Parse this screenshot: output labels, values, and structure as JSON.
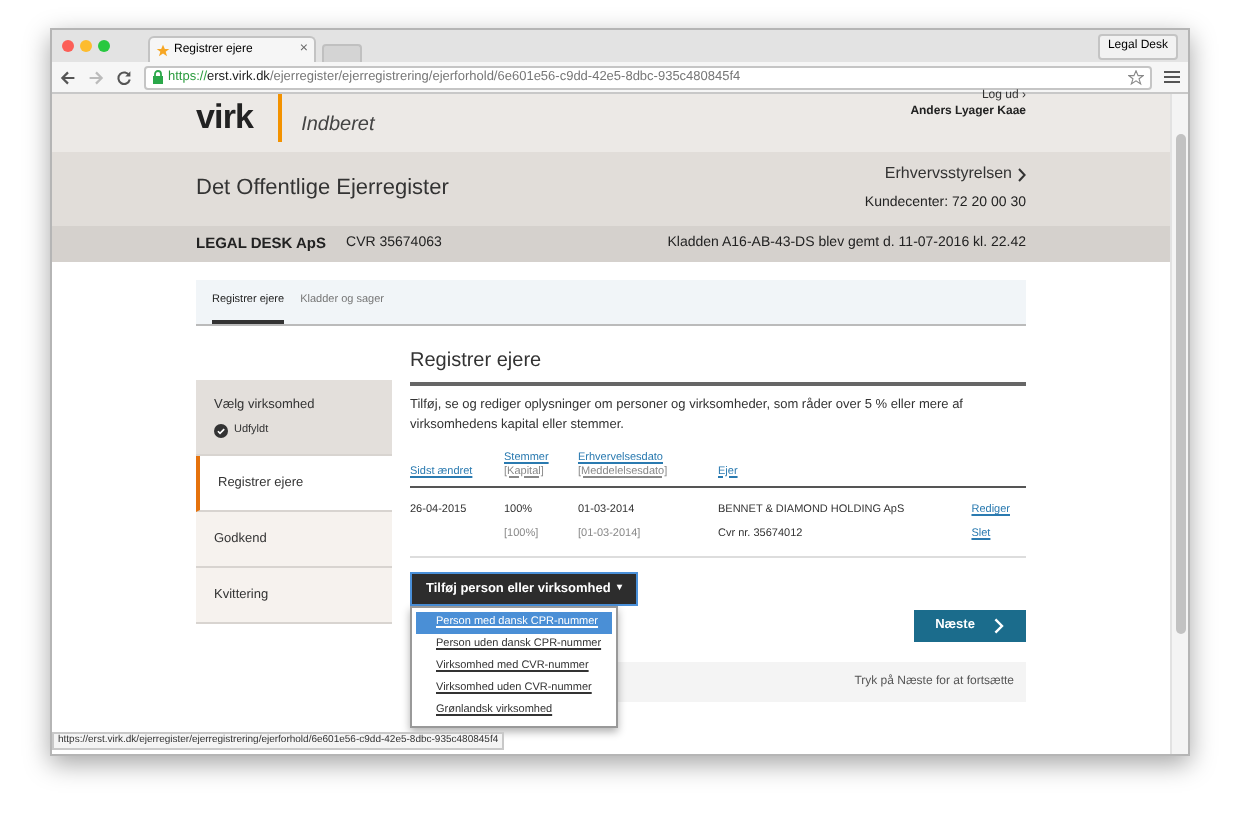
{
  "browser": {
    "tab_title": "Registrer ejere",
    "tab_close": "×",
    "profile": "Legal Desk",
    "url_scheme": "https://",
    "url_host": "erst.virk.dk",
    "url_path": "/ejerregister/ejerregistrering/ejerforhold/6e601e56-c9dd-42e5-8dbc-935c480845f4",
    "status_url": "https://erst.virk.dk/ejerregister/ejerregistrering/ejerforhold/6e601e56-c9dd-42e5-8dbc-935c480845f4"
  },
  "header": {
    "logo": "virk",
    "app": "Indberet",
    "logout": "Log ud ›",
    "user": "Anders Lyager Kaae"
  },
  "site": {
    "title": "Det Offentlige Ejerregister",
    "agency": "Erhvervsstyrelsen",
    "phone": "Kundecenter: 72 20 00 30"
  },
  "company": {
    "name": "LEGAL DESK ApS",
    "cvr": "CVR 35674063",
    "draft_note": "Kladden A16-AB-43-DS blev gemt d. 11-07-2016 kl. 22.42"
  },
  "tabs": [
    {
      "label": "Registrer ejere",
      "selected": true
    },
    {
      "label": "Kladder og sager",
      "selected": false
    }
  ],
  "steps": [
    {
      "label": "Vælg virksomhed",
      "selected": false,
      "done": true,
      "status": "Udfyldt"
    },
    {
      "label": "Registrer ejere",
      "selected": true,
      "done": false
    },
    {
      "label": "Godkend",
      "selected": false,
      "done": false
    },
    {
      "label": "Kvittering",
      "selected": false,
      "done": false
    }
  ],
  "main": {
    "title": "Registrer ejere",
    "intro": "Tilføj, se og rediger oplysninger om personer og virksomheder, som råder over 5 % eller mere af virksomhedens kapital eller stemmer.",
    "columns": [
      {
        "label": "Sidst ændret"
      },
      {
        "label": "Stemmer",
        "sublabel": "[Kapital]"
      },
      {
        "label": "Erhvervelsesdato",
        "sublabel": "[Meddelelsesdato]"
      },
      {
        "label": "Ejer"
      }
    ],
    "rows": [
      {
        "changed": "26-04-2015",
        "votes": "100%",
        "capital": "[100%]",
        "date": "01-03-2014",
        "notice_date": "[01-03-2014]",
        "owner": "BENNET & DIAMOND HOLDING ApS",
        "owner_cvr": "Cvr nr. 35674012",
        "actions": [
          "Rediger",
          "Slet"
        ]
      }
    ],
    "add_button": "Tilføj person eller virksomhed",
    "add_caret": "▾",
    "menu": [
      {
        "label": "Person med dansk CPR-nummer",
        "selected": true
      },
      {
        "label": "Person uden dansk CPR-nummer",
        "selected": false
      },
      {
        "label": "Virksomhed med CVR-nummer",
        "selected": false
      },
      {
        "label": "Virksomhed uden CVR-nummer",
        "selected": false
      },
      {
        "label": "Grønlandsk virksomhed",
        "selected": false
      }
    ],
    "next_button": "Næste",
    "footer_hint": "Tryk på Næste for at fortsætte"
  }
}
